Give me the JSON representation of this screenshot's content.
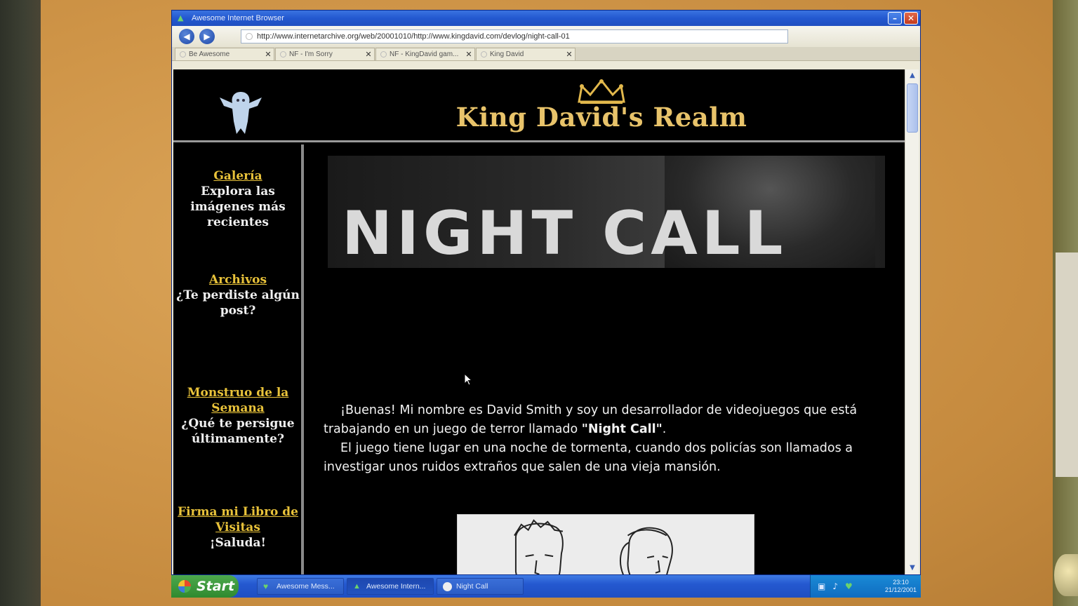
{
  "browser": {
    "title": "Awesome Internet Browser",
    "minimize_glyph": "–",
    "close_glyph": "✕",
    "back_glyph": "◀",
    "forward_glyph": "▶",
    "address": "http://www.internetarchive.org/web/20001010/http://www.kingdavid.com/devlog/night-call-01",
    "tabs": [
      {
        "label": "Be Awesome"
      },
      {
        "label": "NF - I'm Sorry"
      },
      {
        "label": "NF - KingDavid gam..."
      },
      {
        "label": "King David"
      }
    ],
    "tab_close_glyph": "✕"
  },
  "site": {
    "title": "King David's Realm",
    "banner_title": "NIGHT CALL",
    "sidebar": [
      {
        "link": "Galería",
        "desc": "Explora las imágenes más recientes"
      },
      {
        "link": "Archivos",
        "desc": "¿Te perdiste algún post?"
      },
      {
        "link": "Monstruo de la Semana",
        "desc": "¿Qué te persigue últimamente?"
      },
      {
        "link": "Firma mi Libro de Visitas",
        "desc": "¡Saluda!"
      }
    ],
    "intro": {
      "p1_before": "¡Buenas! Mi nombre es David Smith y soy un desarrollador de videojuegos que está trabajando en un juego de terror llamado ",
      "p1_bold": "\"Night Call\"",
      "p1_after": ".",
      "p2": "El juego tiene lugar en una noche de tormenta, cuando dos policías son llamados a investigar unos ruidos extraños que salen de una vieja mansión."
    }
  },
  "taskbar": {
    "start_label": "Start",
    "tasks": [
      {
        "label": "Awesome Mess..."
      },
      {
        "label": "Awesome Intern..."
      },
      {
        "label": "Night Call"
      }
    ],
    "clock_time": "23:10",
    "clock_date": "21/12/2001"
  },
  "icons": {
    "app": "browser-icon",
    "ghost": "ghost-logo",
    "crown": "crown-icon",
    "cursor": "mouse-cursor"
  },
  "colors": {
    "title_gold": "#e8c36a",
    "link_gold": "#e8c23a",
    "titlebar_blue": "#2358d0",
    "bezel": "#cf9548"
  }
}
